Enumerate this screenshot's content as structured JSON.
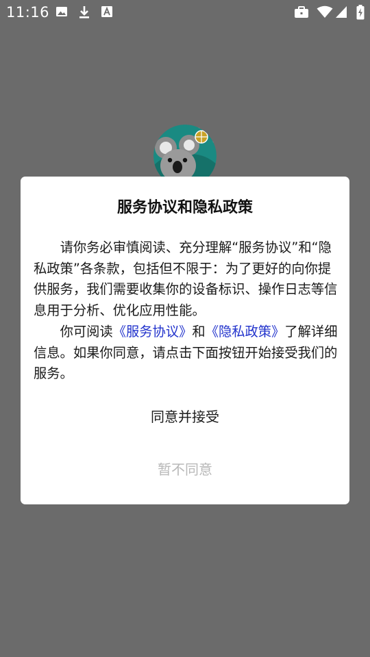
{
  "status_bar": {
    "time": "11:16",
    "left_icons": [
      "image-icon",
      "download-icon",
      "text-icon"
    ],
    "right_icons": [
      "briefcase-icon",
      "wifi-icon",
      "signal-icon",
      "battery-charging-icon"
    ]
  },
  "app": {
    "logo_icon": "koala-logo-icon"
  },
  "dialog": {
    "title": "服务协议和隐私政策",
    "paragraph1": "请你务必审慎阅读、充分理解“服务协议”和“隐私政策”各条款，包括但不限于：为了更好的向你提供服务，我们需要收集你的设备标识、操作日志等信息用于分析、优化应用性能。",
    "paragraph2_prefix": "你可阅读",
    "service_link": "《服务协议》",
    "paragraph2_and": "和",
    "privacy_link": "《隐私政策》",
    "paragraph2_suffix": "了解详细信息。如果你同意，请点击下面按钮开始接受我们的服务。",
    "accept_label": "同意并接受",
    "decline_label": "暂不同意"
  },
  "colors": {
    "overlay": "#6b6b6b",
    "link": "#2233cc",
    "decline_text": "#b8b8b8",
    "dialog_bg": "#ffffff"
  }
}
